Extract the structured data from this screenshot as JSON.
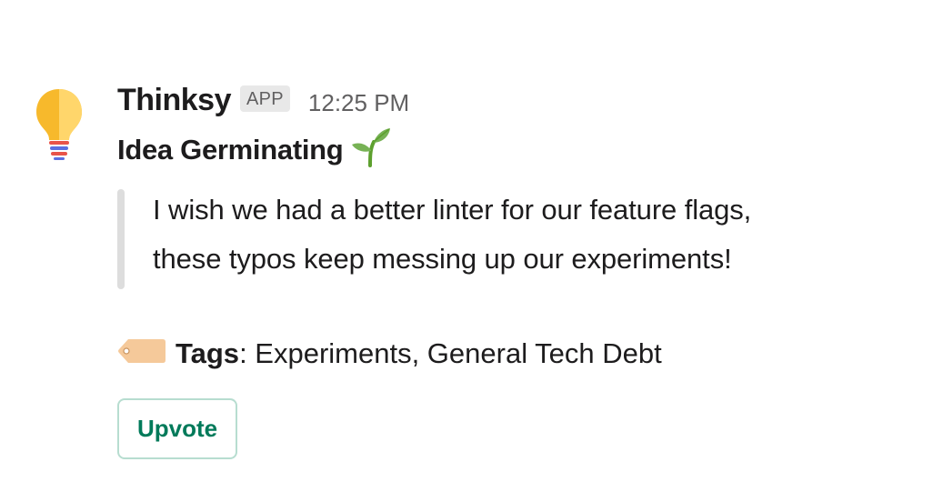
{
  "message": {
    "sender": "Thinksy",
    "badge": "APP",
    "timestamp": "12:25 PM",
    "headline": "Idea Germinating",
    "headline_icon": "sprout-icon",
    "quote": {
      "line1": "I wish we had a better linter for our feature flags,",
      "line2": "these typos keep messing up our experiments!"
    },
    "tags": {
      "icon": "tag-icon",
      "label": "Tags",
      "separator": ": ",
      "values": "Experiments, General Tech Debt"
    },
    "actions": {
      "upvote_label": "Upvote"
    }
  },
  "avatar": {
    "icon": "lightbulb-icon",
    "colors": {
      "bulb_left": "#F7B92C",
      "bulb_right": "#FFD66B",
      "base_red": "#E8534A",
      "base_blue": "#5B6EE1"
    }
  },
  "colors": {
    "accent_green": "#007a5a",
    "button_border": "#b7ddd0",
    "quote_bar": "#dddddd",
    "muted_text": "#616061"
  }
}
